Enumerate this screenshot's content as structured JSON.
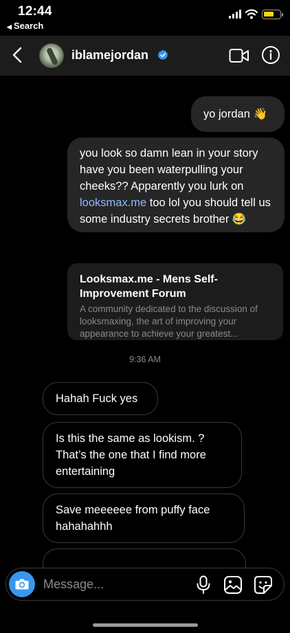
{
  "status_bar": {
    "time": "12:44",
    "back_app": "Search"
  },
  "header": {
    "username": "iblamejordan",
    "verified": true
  },
  "messages": {
    "sent_1": "yo jordan 👋",
    "sent_2_before": "you look so damn lean in your story have you been waterpulling your cheeks?? Apparently you lurk on ",
    "sent_2_link": "looksmax.me",
    "sent_2_after": " too lol you should tell us some industry secrets brother 😂",
    "link_preview": {
      "title": "Looksmax.me - Mens Self-Improvement Forum",
      "description": "A community dedicated to the discussion of looksmaxing, the art of improving your appearance to achieve your greatest..."
    },
    "timestamp": "9:36 AM",
    "received_1": "Hahah Fuck yes",
    "received_2": "Is this the same as lookism. ? That’s the one that I find more entertaining",
    "received_3": "Save meeeeee from puffy face hahahahhh"
  },
  "composer": {
    "placeholder": "Message..."
  },
  "colors": {
    "accent": "#3797f0",
    "link": "#8fb8ff",
    "verified": "#3797f0",
    "battery": "#ffd60a"
  }
}
